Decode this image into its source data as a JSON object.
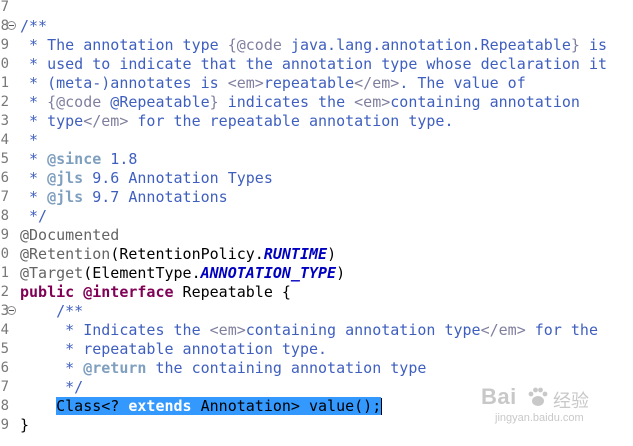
{
  "editor": {
    "lines": [
      {
        "num": "7",
        "fold": false,
        "tokens": []
      },
      {
        "num": "8",
        "fold": true,
        "tokens": [
          {
            "t": "/**",
            "c": "cm"
          }
        ]
      },
      {
        "num": "9",
        "fold": false,
        "tokens": [
          {
            "t": " * The annotation type ",
            "c": "cm"
          },
          {
            "t": "{@code",
            "c": "tag"
          },
          {
            "t": " java.lang.annotation.Repeatable",
            "c": "cm"
          },
          {
            "t": "}",
            "c": "tag"
          },
          {
            "t": " is",
            "c": "cm"
          }
        ]
      },
      {
        "num": "0",
        "fold": false,
        "tokens": [
          {
            "t": " * used to indicate that the annotation type whose declaration it",
            "c": "cm"
          }
        ]
      },
      {
        "num": "1",
        "fold": false,
        "tokens": [
          {
            "t": " * (meta-)annotates is ",
            "c": "cm"
          },
          {
            "t": "<em>",
            "c": "tag"
          },
          {
            "t": "repeatable",
            "c": "cm"
          },
          {
            "t": "</em>",
            "c": "tag"
          },
          {
            "t": ". The value of",
            "c": "cm"
          }
        ]
      },
      {
        "num": "2",
        "fold": false,
        "tokens": [
          {
            "t": " * ",
            "c": "cm"
          },
          {
            "t": "{@code",
            "c": "tag"
          },
          {
            "t": " @Repeatable",
            "c": "cm"
          },
          {
            "t": "}",
            "c": "tag"
          },
          {
            "t": " indicates the ",
            "c": "cm"
          },
          {
            "t": "<em>",
            "c": "tag"
          },
          {
            "t": "containing annotation",
            "c": "cm"
          }
        ]
      },
      {
        "num": "3",
        "fold": false,
        "tokens": [
          {
            "t": " * type",
            "c": "cm"
          },
          {
            "t": "</em>",
            "c": "tag"
          },
          {
            "t": " for the repeatable annotation type.",
            "c": "cm"
          }
        ]
      },
      {
        "num": "4",
        "fold": false,
        "tokens": [
          {
            "t": " *",
            "c": "cm"
          }
        ]
      },
      {
        "num": "5",
        "fold": false,
        "tokens": [
          {
            "t": " * ",
            "c": "cm"
          },
          {
            "t": "@since",
            "c": "jdk"
          },
          {
            "t": " 1.8",
            "c": "cm"
          }
        ]
      },
      {
        "num": "6",
        "fold": false,
        "tokens": [
          {
            "t": " * ",
            "c": "cm"
          },
          {
            "t": "@jls",
            "c": "jdk"
          },
          {
            "t": " 9.6 Annotation Types",
            "c": "cm"
          }
        ]
      },
      {
        "num": "7",
        "fold": false,
        "tokens": [
          {
            "t": " * ",
            "c": "cm"
          },
          {
            "t": "@jls",
            "c": "jdk"
          },
          {
            "t": " 9.7 Annotations",
            "c": "cm"
          }
        ]
      },
      {
        "num": "8",
        "fold": false,
        "tokens": [
          {
            "t": " */",
            "c": "cm"
          }
        ]
      },
      {
        "num": "9",
        "fold": false,
        "tokens": [
          {
            "t": "@Documented",
            "c": "an"
          }
        ]
      },
      {
        "num": "0",
        "fold": false,
        "tokens": [
          {
            "t": "@Retention",
            "c": "an"
          },
          {
            "t": "(RetentionPolicy.",
            "c": "tx"
          },
          {
            "t": "RUNTIME",
            "c": "fld"
          },
          {
            "t": ")",
            "c": "tx"
          }
        ]
      },
      {
        "num": "1",
        "fold": false,
        "tokens": [
          {
            "t": "@Target",
            "c": "an"
          },
          {
            "t": "(ElementType.",
            "c": "tx"
          },
          {
            "t": "ANNOTATION_TYPE",
            "c": "fld"
          },
          {
            "t": ")",
            "c": "tx"
          }
        ]
      },
      {
        "num": "2",
        "fold": false,
        "tokens": [
          {
            "t": "public",
            "c": "kw"
          },
          {
            "t": " ",
            "c": "tx"
          },
          {
            "t": "@interface",
            "c": "kw"
          },
          {
            "t": " Repeatable {",
            "c": "tx"
          }
        ]
      },
      {
        "num": "3",
        "fold": true,
        "tokens": [
          {
            "t": "    /**",
            "c": "cm"
          }
        ]
      },
      {
        "num": "4",
        "fold": false,
        "tokens": [
          {
            "t": "     * Indicates the ",
            "c": "cm"
          },
          {
            "t": "<em>",
            "c": "tag"
          },
          {
            "t": "containing annotation type",
            "c": "cm"
          },
          {
            "t": "</em>",
            "c": "tag"
          },
          {
            "t": " for the",
            "c": "cm"
          }
        ]
      },
      {
        "num": "5",
        "fold": false,
        "tokens": [
          {
            "t": "     * repeatable annotation type.",
            "c": "cm"
          }
        ]
      },
      {
        "num": "6",
        "fold": false,
        "tokens": [
          {
            "t": "     * ",
            "c": "cm"
          },
          {
            "t": "@return",
            "c": "jdk"
          },
          {
            "t": " the containing annotation type",
            "c": "cm"
          }
        ]
      },
      {
        "num": "7",
        "fold": false,
        "tokens": [
          {
            "t": "     */",
            "c": "cm"
          }
        ]
      },
      {
        "num": "8",
        "fold": false,
        "tokens": [
          {
            "t": "    ",
            "c": "tx"
          },
          {
            "t": "Class<? ",
            "c": "tx",
            "sel": true
          },
          {
            "t": "extends",
            "c": "kw",
            "sel": true
          },
          {
            "t": " Annotation> value();",
            "c": "tx",
            "sel": true
          }
        ],
        "caret": true
      },
      {
        "num": "9",
        "fold": false,
        "tokens": [
          {
            "t": "}",
            "c": "tx"
          }
        ]
      }
    ],
    "colors": {
      "comment": "#3f5fbf",
      "javadoc_tag": "#7f9fbf",
      "html_tag": "#7f7f9f",
      "annotation": "#646464",
      "keyword": "#7f0055",
      "static_field": "#0000c0",
      "selection": "#3399ff"
    }
  },
  "watermark": {
    "logo": "Bai",
    "logo_icon": "paw-icon",
    "text": "经验",
    "url": "jingyan.baidu.com"
  }
}
